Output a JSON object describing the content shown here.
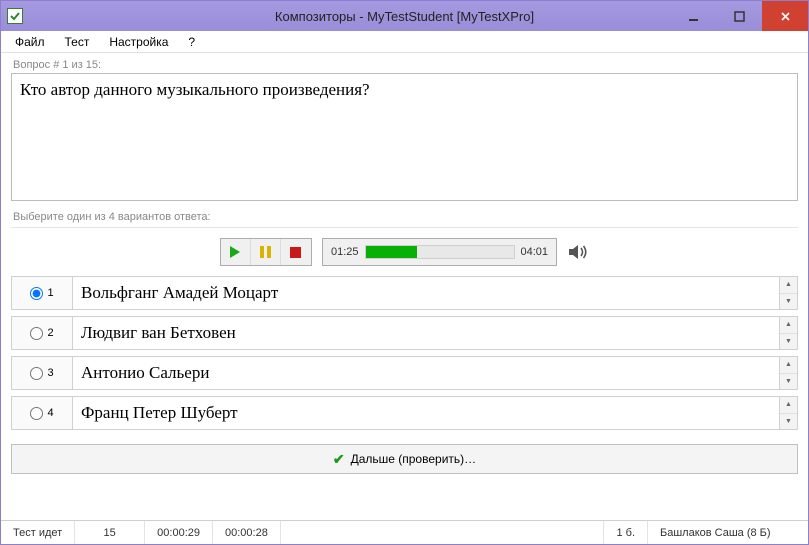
{
  "window": {
    "title": "Композиторы - MyTestStudent [MyTestXPro]"
  },
  "menu": {
    "file": "Файл",
    "test": "Тест",
    "settings": "Настройка",
    "help": "?"
  },
  "question": {
    "counter": "Вопрос # 1 из 15:",
    "text": "Кто автор данного музыкального произведения?",
    "instruction": "Выберите один из 4 вариантов ответа:"
  },
  "player": {
    "current": "01:25",
    "total": "04:01",
    "progress_percent": 35
  },
  "answers": [
    {
      "num": "1",
      "text": "Вольфганг Амадей Моцарт",
      "selected": true
    },
    {
      "num": "2",
      "text": "Людвиг ван Бетховен",
      "selected": false
    },
    {
      "num": "3",
      "text": "Антонио Сальери",
      "selected": false
    },
    {
      "num": "4",
      "text": "Франц Петер Шуберт",
      "selected": false
    }
  ],
  "next_button": "Дальше (проверить)…",
  "status": {
    "label": "Тест идет",
    "total_q": "15",
    "time1": "00:00:29",
    "time2": "00:00:28",
    "score": "1 б.",
    "user": "Башлаков Саша (8 Б)"
  }
}
